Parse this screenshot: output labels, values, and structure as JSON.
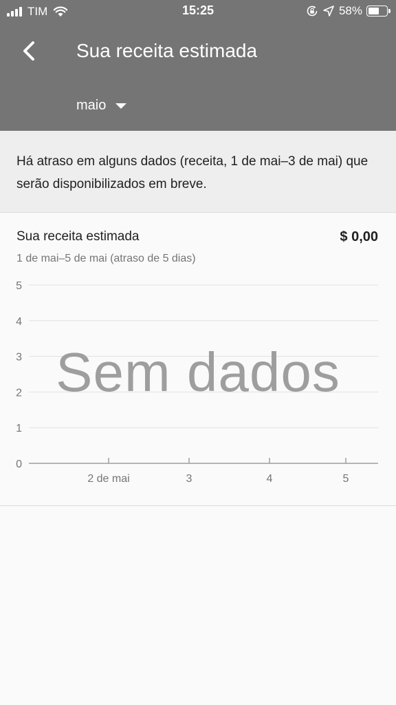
{
  "status_bar": {
    "carrier": "TIM",
    "time": "15:25",
    "battery_percent": "58%",
    "battery_level": 0.58,
    "icons": [
      "signal-icon",
      "wifi-icon",
      "rotation-lock-icon",
      "location-arrow-icon",
      "battery-icon"
    ]
  },
  "header": {
    "back_icon": "chevron-left-icon",
    "title": "Sua receita estimada",
    "month_selector": "maio",
    "month_caret_icon": "caret-down-icon"
  },
  "notice": {
    "text": "Há atraso em alguns dados (receita, 1 de mai–3 de mai) que serão disponibilizados em breve."
  },
  "card": {
    "title": "Sua receita estimada",
    "amount": "$ 0,00",
    "range": "1 de mai–5 de mai (atraso de 5 dias)",
    "empty_message": "Sem dados"
  },
  "chart_data": {
    "type": "line",
    "x_tick_labels": [
      "2 de mai",
      "3",
      "4",
      "5"
    ],
    "y_tick_labels": [
      "0",
      "1",
      "2",
      "3",
      "4",
      "5"
    ],
    "ylim": [
      0,
      5
    ],
    "series": [],
    "grid": true
  }
}
